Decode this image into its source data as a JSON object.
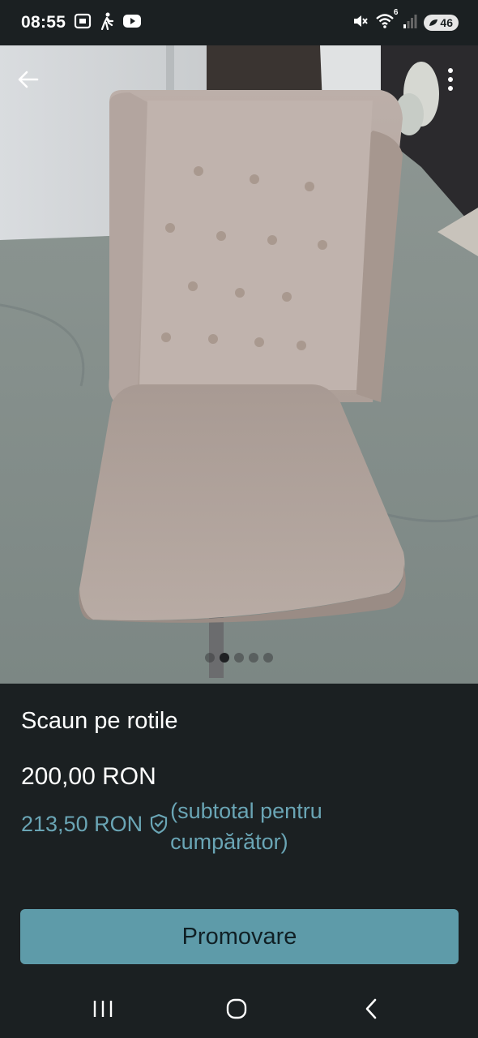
{
  "status_bar": {
    "time": "08:55",
    "left_icons": [
      "screenshot-icon",
      "walking-person-icon",
      "youtube-icon"
    ],
    "right_icons": [
      "mute-icon",
      "wifi-icon",
      "signal-icon"
    ],
    "wifi_badge": "6",
    "battery": "46"
  },
  "image_viewer": {
    "back_icon": "arrow-left-icon",
    "menu_icon": "more-vertical-icon",
    "image_count": 5,
    "active_image": 1
  },
  "listing": {
    "title": "Scaun pe rotile",
    "price": "200,00 RON",
    "buyer_price": "213,50 RON",
    "buyer_note": "(subtotal pentru cumpărător)"
  },
  "actions": {
    "promote_label": "Promovare"
  },
  "nav_bar": {
    "recents_icon": "recent-apps-icon",
    "home_icon": "home-icon",
    "back_icon": "back-chevron-icon"
  },
  "colors": {
    "background": "#1b2022",
    "accent": "#5e9ba9",
    "buyer_price": "#6aa5b5"
  }
}
